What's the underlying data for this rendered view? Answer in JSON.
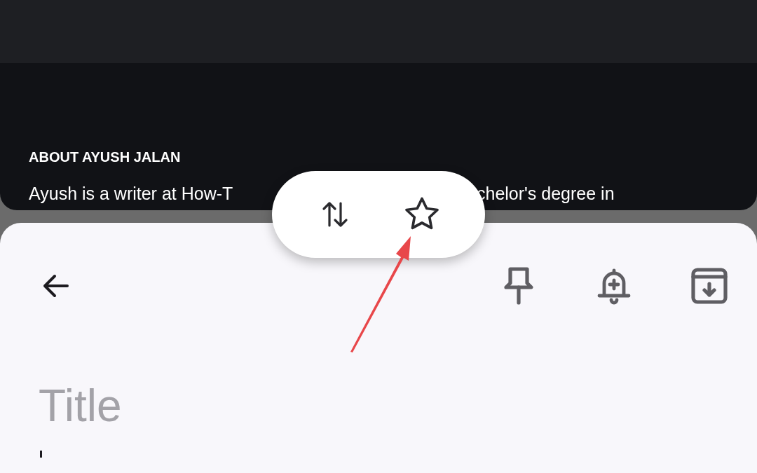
{
  "article_panel": {
    "heading": "ABOUT AYUSH JALAN",
    "bio_fragments": [
      "Ayush is a writer at How-T",
      "chelor's degree in"
    ]
  },
  "popup_menu": {
    "buttons": [
      {
        "kind": "sort"
      },
      {
        "kind": "star"
      }
    ]
  },
  "note_editor": {
    "toolbar": [
      {
        "kind": "back"
      },
      {
        "kind": "pin"
      },
      {
        "kind": "reminder"
      },
      {
        "kind": "archive"
      }
    ],
    "title": {
      "placeholder": "Title"
    }
  }
}
